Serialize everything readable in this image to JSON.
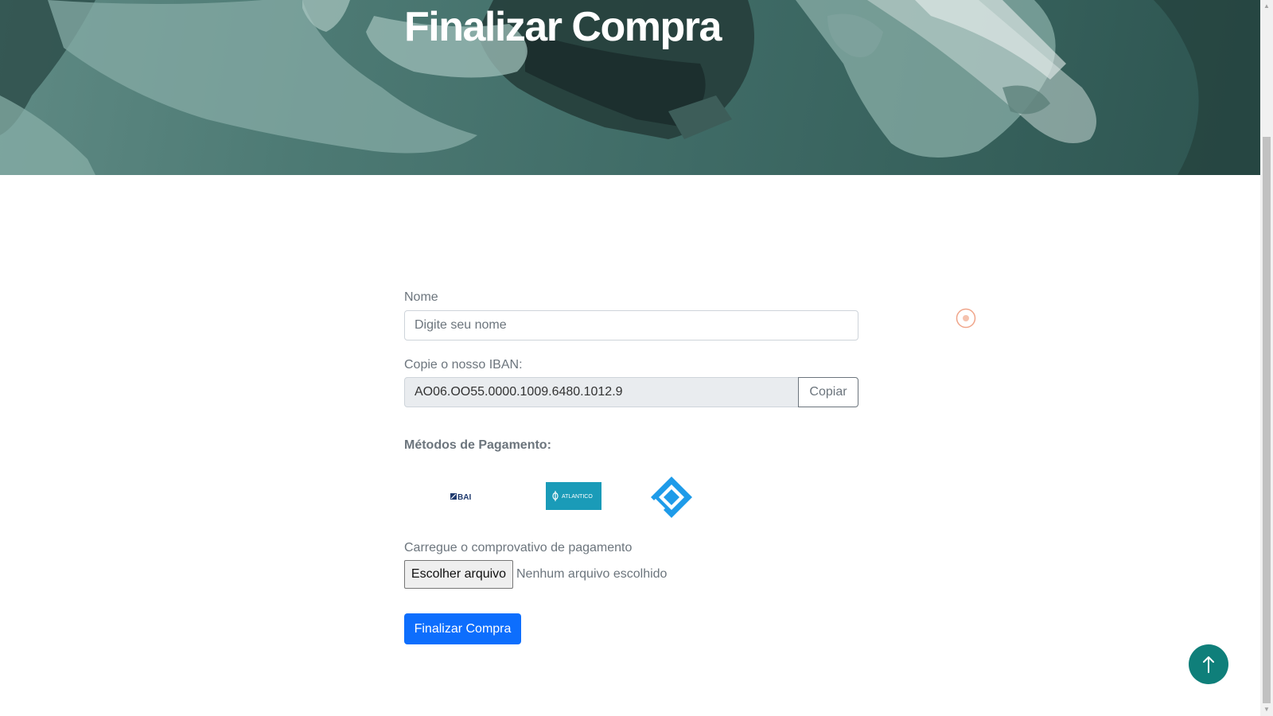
{
  "hero": {
    "title": "Finalizar Compra"
  },
  "form": {
    "name_label": "Nome",
    "name_placeholder": "Digite seu nome",
    "iban_label": "Copie o nosso IBAN:",
    "iban_value": "AO06.OO55.0000.1009.6480.1012.9",
    "copy_button": "Copiar",
    "payment_methods_title": "Métodos de Pagamento:",
    "payment_methods": [
      {
        "name": "BAI",
        "logo_text": "BAI"
      },
      {
        "name": "Atlântico",
        "logo_text": "ATLANTICO"
      },
      {
        "name": "Multicaixa",
        "logo_text": ""
      }
    ],
    "upload_label": "Carregue o comprovativo de pagamento",
    "file_button": "Escolher arquivo",
    "file_status": "Nenhum arquivo escolhido",
    "submit_button": "Finalizar Compra"
  },
  "scroll_top": {
    "icon": "arrow-up-icon"
  },
  "colors": {
    "hero_tint": "#3f6b66",
    "primary": "#0d6efd",
    "scroll_top_bg": "#0f7f7a",
    "atlantico": "#1a9bb8",
    "multicaixa": "#1e9be9",
    "bai": "#1f3a6e",
    "radio_accent": "#f0a58a"
  }
}
